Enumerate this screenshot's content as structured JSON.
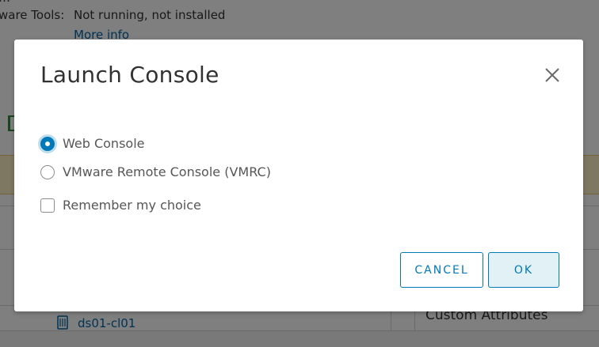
{
  "background": {
    "tools_label": "ware Tools:",
    "tools_value": "Not running, not installed",
    "more_info_link": "More info",
    "datastore_link": "ds01-cl01",
    "custom_attributes_title": "Custom Attributes"
  },
  "modal": {
    "title": "Launch Console",
    "options": [
      {
        "label": "Web Console",
        "selected": true
      },
      {
        "label": "VMware Remote Console (VMRC)",
        "selected": false
      }
    ],
    "remember_label": "Remember my choice",
    "remember_checked": false,
    "cancel_label": "CANCEL",
    "ok_label": "OK"
  },
  "colors": {
    "accent": "#0079b8",
    "overlay": "rgba(0,0,0,0.5)",
    "warning_banner": "#fcefc4"
  },
  "icons": {
    "close": "close-icon",
    "datastore": "datastore-icon"
  }
}
